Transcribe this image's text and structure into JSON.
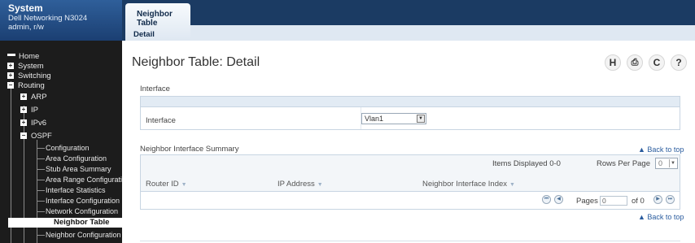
{
  "sidebar": {
    "system_title": "System",
    "device_name": "Dell Networking N3024",
    "user": "admin, r/w",
    "items": [
      {
        "label": "Home"
      },
      {
        "label": "System"
      },
      {
        "label": "Switching"
      },
      {
        "label": "Routing"
      },
      {
        "label": "ARP"
      },
      {
        "label": "IP"
      },
      {
        "label": "IPv6"
      },
      {
        "label": "OSPF"
      }
    ],
    "ospf_items": [
      {
        "label": "Configuration"
      },
      {
        "label": "Area Configuration"
      },
      {
        "label": "Stub Area Summary"
      },
      {
        "label": "Area Range Configuration"
      },
      {
        "label": "Interface Statistics"
      },
      {
        "label": "Interface Configuration"
      },
      {
        "label": "Network Configuration"
      },
      {
        "label": "Neighbor Table"
      },
      {
        "label": "Neighbor Configuration"
      }
    ],
    "expand_plus": "+",
    "collapse_minus": "−"
  },
  "tabs": {
    "active_tab": "Neighbor Table",
    "active_subtab": "Detail"
  },
  "page": {
    "title": "Neighbor Table: Detail",
    "icons": [
      {
        "name": "help-icon",
        "glyph": "H"
      },
      {
        "name": "print-icon",
        "glyph": "⎙"
      },
      {
        "name": "refresh-icon",
        "glyph": "C"
      },
      {
        "name": "question-icon",
        "glyph": "?"
      }
    ]
  },
  "interface_section": {
    "header": "Interface",
    "label": "Interface",
    "value": "Vlan1"
  },
  "summary_section": {
    "header": "Neighbor Interface Summary",
    "back_to_top": "▲ Back to top",
    "items_displayed": "Items Displayed 0-0",
    "rows_per_page_label": "Rows Per Page",
    "rows_per_page_value": "0",
    "columns": [
      "Router ID",
      "IP Address",
      "Neighbor Interface Index"
    ],
    "pages_label": "Pages",
    "page_value": "0",
    "of_label": "of 0",
    "back_to_top_bottom": "▲ Back to top"
  },
  "colors": {
    "sidebar_bg": "#1c1c1c",
    "header_blue": "#1b3b63",
    "link": "#2a5c9e"
  }
}
